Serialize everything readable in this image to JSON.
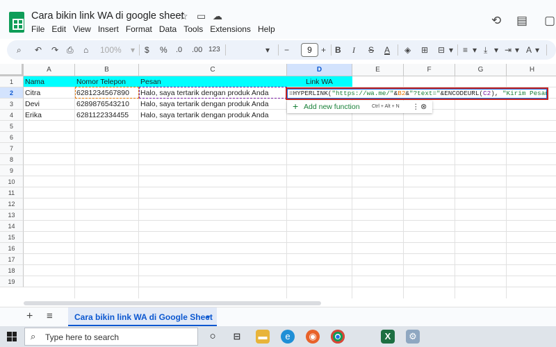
{
  "doc_title": "Cara bikin link WA di google sheet",
  "menu": [
    "File",
    "Edit",
    "View",
    "Insert",
    "Format",
    "Data",
    "Tools",
    "Extensions",
    "Help"
  ],
  "toolbar": {
    "zoom": "100%",
    "currency": "$",
    "percent": "%",
    "dec_decrease": ".0",
    "dec_increase": ".00",
    "number_format": "123",
    "font_size": "9",
    "minus": "−",
    "plus": "+",
    "bold": "B",
    "italic": "I",
    "strike": "S",
    "text_color": "A"
  },
  "columns": [
    "A",
    "B",
    "C",
    "D",
    "E",
    "F",
    "G",
    "H"
  ],
  "rows": [
    "1",
    "2",
    "3",
    "4",
    "5",
    "6",
    "7",
    "8",
    "9",
    "10",
    "11",
    "12",
    "13",
    "14",
    "15",
    "16",
    "17",
    "18",
    "19"
  ],
  "headers": {
    "a": "Nama",
    "b": "Nomor Telepon",
    "c": "Pesan",
    "d": "Link WA"
  },
  "data_rows": [
    {
      "nama": "Citra",
      "telepon": "6281234567890",
      "pesan": "Halo, saya tertarik dengan produk Anda"
    },
    {
      "nama": "Devi",
      "telepon": "6289876543210",
      "pesan": "Halo, saya tertarik dengan produk Anda"
    },
    {
      "nama": "Erika",
      "telepon": "6281122334455",
      "pesan": "Halo, saya tertarik dengan produk Anda"
    }
  ],
  "formula": {
    "p1": "=HYPERLINK(",
    "s1": "\"https://wa.me/\"",
    "p2": "&",
    "r1": "B2",
    "p3": "&",
    "s2": "\"?text=\"",
    "p4": "&ENCODEURL(",
    "r2": "C2",
    "p5": "), ",
    "s3": "\"Kirim Pesan\"",
    "p6": ")"
  },
  "autocomplete": {
    "label": "Add new function",
    "shortcut": "Ctrl + Alt + N"
  },
  "sheet_tab": "Cara bikin link WA di Google Sheet",
  "taskbar": {
    "search_placeholder": "Type here to search"
  },
  "colors": {
    "header_fill": "#00ffff",
    "formula_border": "#c5221f",
    "accent": "#0b57d0"
  }
}
